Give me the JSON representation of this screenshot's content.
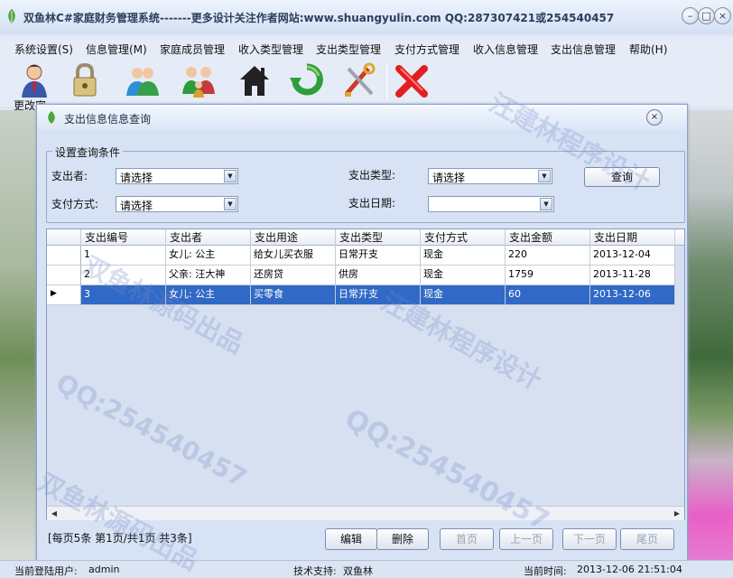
{
  "window": {
    "title": "双鱼林C#家庭财务管理系统-------更多设计关注作者网站:www.shuangyulin.com  QQ:287307421或254540457",
    "minimize_glyph": "–",
    "maximize_glyph": "□",
    "close_glyph": "×"
  },
  "menu": [
    "系统设置(S)",
    "信息管理(M)",
    "家庭成员管理",
    "收入类型管理",
    "支出类型管理",
    "支付方式管理",
    "收入信息管理",
    "支出信息管理",
    "帮助(H)"
  ],
  "toolbar": {
    "first_label": "更改密",
    "icons": [
      "user-icon",
      "lock-icon",
      "users-icon",
      "family-icon",
      "home-icon",
      "refresh-icon",
      "tools-icon",
      "exit-icon"
    ]
  },
  "dialog": {
    "title": "支出信息信息查询",
    "close_glyph": "×",
    "group_title": "设置查询条件",
    "payer_label": "支出者:",
    "payer_value": "请选择",
    "type_label": "支出类型:",
    "type_value": "请选择",
    "method_label": "支付方式:",
    "method_value": "请选择",
    "date_label": "支出日期:",
    "date_value": "",
    "query_button": "查询"
  },
  "table": {
    "columns": [
      "支出编号",
      "支出者",
      "支出用途",
      "支出类型",
      "支付方式",
      "支出金额",
      "支出日期"
    ],
    "rows": [
      [
        "1",
        "女儿: 公主",
        "给女儿买衣服",
        "日常开支",
        "现金",
        "220",
        "2013-12-04"
      ],
      [
        "2",
        "父亲: 汪大神",
        "还房贷",
        "供房",
        "现金",
        "1759",
        "2013-11-28"
      ],
      [
        "3",
        "女儿: 公主",
        "买零食",
        "日常开支",
        "现金",
        "60",
        "2013-12-06"
      ]
    ],
    "selected_row": 2,
    "row_indicator": "▶"
  },
  "paging": {
    "info": "[每页5条  第1页/共1页    共3条]",
    "edit_button": "编辑",
    "delete_button": "删除",
    "first_button": "首页",
    "prev_button": "上一页",
    "next_button": "下一页",
    "last_button": "尾页"
  },
  "status": {
    "user_label": "当前登陆用户:",
    "user_value": "admin",
    "support_label": "技术支持:",
    "support_value": "双鱼林",
    "time_label": "当前时间:",
    "time_value": "2013-12-06 21:51:04"
  },
  "watermarks": [
    "双鱼林源码出品",
    "汪建林程序设计",
    "QQ:254540457"
  ],
  "colors": {
    "selection": "#3169c6",
    "dialog_bg": "#d7e2f5",
    "exit_red": "#e02020"
  }
}
